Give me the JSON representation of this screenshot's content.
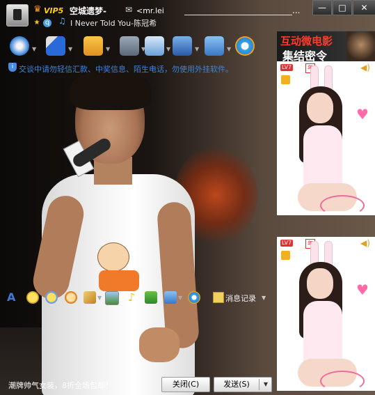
{
  "window": {
    "vip_label": "VIP5",
    "contact_name": "空城遗梦-",
    "contact_email": "<mr.lei",
    "email_ellipsis": "...",
    "now_playing": "I Never Told You-陈冠希",
    "controls": {
      "minimize": "—",
      "maximize": "□",
      "close": "✕"
    }
  },
  "toolbar": {
    "icons": [
      "video-call",
      "voice-call",
      "send-file",
      "send-sms",
      "create-discussion",
      "app-box",
      "remote-assist",
      "skype"
    ]
  },
  "notice": {
    "text": "交谈中请勿轻信汇款、中奖信息、陌生电话，勿使用外挂软件。"
  },
  "right_panel": {
    "ad_line1": "互动微电影",
    "ad_line2": "集结密令",
    "show_badge_level": "LV7",
    "show_badge_year": "年"
  },
  "input_toolbar": {
    "icons": [
      "font",
      "emoji",
      "magic-emoji",
      "nudge",
      "screenshot",
      "image",
      "music",
      "mini-game",
      "remote-desktop",
      "skype"
    ],
    "history_label": "消息记录"
  },
  "bottom": {
    "ad_text": "潮牌帅气女装，8折全场包邮！",
    "close_label": "关闭(C)",
    "send_label": "发送(S)"
  },
  "colors": {
    "vip": "#ffd000",
    "notice": "#3a86e0",
    "ad_red": "#ff3b2a"
  }
}
